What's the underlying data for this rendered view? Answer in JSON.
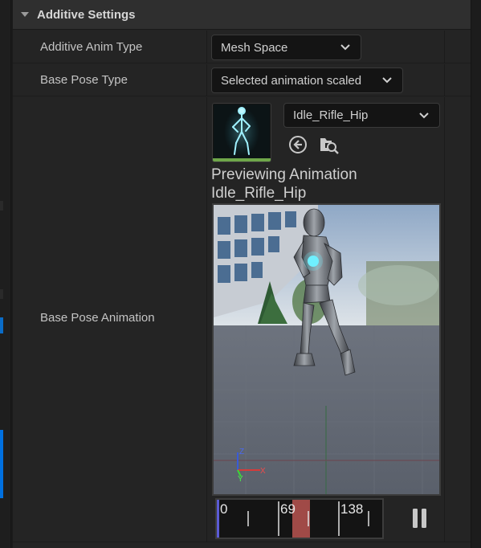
{
  "section": {
    "title": "Additive Settings"
  },
  "rows": {
    "additive_anim_type": {
      "label": "Additive Anim Type",
      "value": "Mesh Space"
    },
    "base_pose_type": {
      "label": "Base Pose Type",
      "value": "Selected animation scaled"
    },
    "base_pose_animation": {
      "label": "Base Pose Animation",
      "asset_value": "Idle_Rifle_Hip",
      "preview_line1": "Previewing Animation",
      "preview_line2": "Idle_Rifle_Hip"
    }
  },
  "timeline": {
    "frame_start": "0",
    "frame_current": "69",
    "frame_mid": "138",
    "playhead_fraction": 0.5
  },
  "icons": {
    "collapse": "chevron-down-icon",
    "combo_arrow": "chevron-down-icon",
    "use_selected": "arrow-left-circle-icon",
    "browse": "folder-search-icon",
    "pause": "pause-icon",
    "axis_gizmo": "axis-gizmo-icon"
  },
  "colors": {
    "panel_bg": "#242424",
    "header_bg": "#2f2f2f",
    "field_bg": "#141414",
    "thumb_bar": "#6fa74a",
    "playhead": "#a04a47",
    "timeline_start": "#5b5bd6",
    "left_accent": "#0070e0"
  }
}
